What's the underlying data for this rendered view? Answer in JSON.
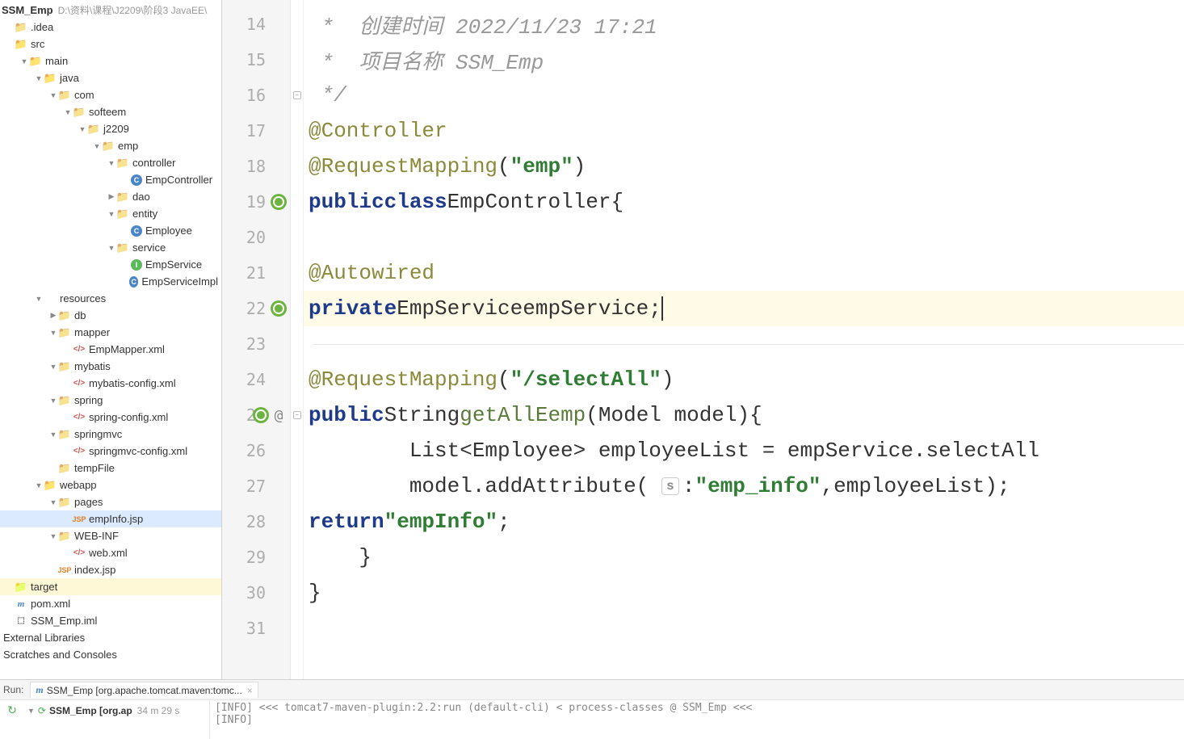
{
  "project": {
    "name": "SSM_Emp",
    "path": "D:\\资料\\课程\\J2209\\阶段3 JavaEE\\"
  },
  "tree": [
    {
      "depth": 0,
      "arrow": "none",
      "icon": "folder",
      "label": ".idea"
    },
    {
      "depth": 0,
      "arrow": "none",
      "icon": "folder-blue",
      "label": "src"
    },
    {
      "depth": 1,
      "arrow": "down",
      "icon": "folder-blue",
      "label": "main"
    },
    {
      "depth": 2,
      "arrow": "down",
      "icon": "folder-blue",
      "label": "java"
    },
    {
      "depth": 3,
      "arrow": "down",
      "icon": "folder",
      "label": "com"
    },
    {
      "depth": 4,
      "arrow": "down",
      "icon": "folder",
      "label": "softeem"
    },
    {
      "depth": 5,
      "arrow": "down",
      "icon": "folder",
      "label": "j2209"
    },
    {
      "depth": 6,
      "arrow": "down",
      "icon": "folder",
      "label": "emp"
    },
    {
      "depth": 7,
      "arrow": "down",
      "icon": "folder",
      "label": "controller"
    },
    {
      "depth": 8,
      "arrow": "none",
      "icon": "class",
      "iconText": "C",
      "label": "EmpController"
    },
    {
      "depth": 7,
      "arrow": "right",
      "icon": "folder",
      "label": "dao"
    },
    {
      "depth": 7,
      "arrow": "down",
      "icon": "folder",
      "label": "entity"
    },
    {
      "depth": 8,
      "arrow": "none",
      "icon": "class",
      "iconText": "C",
      "label": "Employee"
    },
    {
      "depth": 7,
      "arrow": "down",
      "icon": "folder",
      "label": "service"
    },
    {
      "depth": 8,
      "arrow": "none",
      "icon": "iface",
      "iconText": "I",
      "label": "EmpService"
    },
    {
      "depth": 8,
      "arrow": "none",
      "icon": "class",
      "iconText": "C",
      "label": "EmpServiceImpl"
    },
    {
      "depth": 2,
      "arrow": "down",
      "icon": "folder-res",
      "label": "resources"
    },
    {
      "depth": 3,
      "arrow": "right",
      "icon": "folder",
      "label": "db"
    },
    {
      "depth": 3,
      "arrow": "down",
      "icon": "folder",
      "label": "mapper"
    },
    {
      "depth": 4,
      "arrow": "none",
      "icon": "xml",
      "iconText": "</>",
      "label": "EmpMapper.xml"
    },
    {
      "depth": 3,
      "arrow": "down",
      "icon": "folder",
      "label": "mybatis"
    },
    {
      "depth": 4,
      "arrow": "none",
      "icon": "xml",
      "iconText": "</>",
      "label": "mybatis-config.xml"
    },
    {
      "depth": 3,
      "arrow": "down",
      "icon": "folder",
      "label": "spring"
    },
    {
      "depth": 4,
      "arrow": "none",
      "icon": "xml",
      "iconText": "</>",
      "label": "spring-config.xml"
    },
    {
      "depth": 3,
      "arrow": "down",
      "icon": "folder",
      "label": "springmvc"
    },
    {
      "depth": 4,
      "arrow": "none",
      "icon": "xml",
      "iconText": "</>",
      "label": "springmvc-config.xml"
    },
    {
      "depth": 3,
      "arrow": "none",
      "icon": "folder",
      "label": "tempFile"
    },
    {
      "depth": 2,
      "arrow": "down",
      "icon": "folder-blue",
      "label": "webapp"
    },
    {
      "depth": 3,
      "arrow": "down",
      "icon": "folder",
      "label": "pages"
    },
    {
      "depth": 4,
      "arrow": "none",
      "icon": "jsp",
      "iconText": "JSP",
      "label": "empInfo.jsp",
      "selected": true
    },
    {
      "depth": 3,
      "arrow": "down",
      "icon": "folder",
      "label": "WEB-INF"
    },
    {
      "depth": 4,
      "arrow": "none",
      "icon": "xml",
      "iconText": "</>",
      "label": "web.xml"
    },
    {
      "depth": 3,
      "arrow": "none",
      "icon": "jsp",
      "iconText": "JSP",
      "label": "index.jsp"
    },
    {
      "depth": 0,
      "arrow": "none",
      "icon": "folder-yellow",
      "label": "target",
      "highlight": true
    },
    {
      "depth": 0,
      "arrow": "none",
      "icon": "pom",
      "iconText": "m",
      "label": "pom.xml"
    },
    {
      "depth": 0,
      "arrow": "none",
      "icon": "iml",
      "iconText": "⬚",
      "label": "SSM_Emp.iml"
    }
  ],
  "treeExtra": [
    "External Libraries",
    "Scratches and Consoles"
  ],
  "code": {
    "startLine": 14,
    "comment1": " *  创建时间 2022/11/23 17:21",
    "comment2": " *  项目名称 SSM_Emp",
    "comment3": " */",
    "ann1": "@Controller",
    "ann2a": "@RequestMapping",
    "ann2b": "(",
    "ann2c": "\"emp\"",
    "ann2d": ")",
    "kw_public": "public",
    "kw_class": "class",
    "kw_private": "private",
    "kw_return": "return",
    "cls": "EmpController",
    "brace": "{",
    "ann3": "@Autowired",
    "svcType": "EmpService",
    "svcField": "empService",
    "ann4a": "@RequestMapping",
    "ann4b": "(",
    "ann4c": "\"/selectAll\"",
    "ann4d": ")",
    "retType": "String",
    "fn": "getAllEemp",
    "sig": "(Model model){",
    "l26": "        List<Employee> employeeList = empService.selectAll",
    "l27a": "        model.addAttribute( ",
    "paramBadge": "s:",
    "l27b": "\"emp_info\"",
    "l27c": ",employeeList);",
    "l28b": "\"empInfo\"",
    "l28c": ";",
    "l29": "    }",
    "l30": "}"
  },
  "run": {
    "label": "Run:",
    "tab": "SSM_Emp [org.apache.tomcat.maven:tomc...",
    "node": "SSM_Emp [org.ap",
    "time": "34 m 29 s",
    "out1": "[INFO] <<< tomcat7-maven-plugin:2.2:run (default-cli) < process-classes @ SSM_Emp <<<",
    "out2": "[INFO]"
  }
}
